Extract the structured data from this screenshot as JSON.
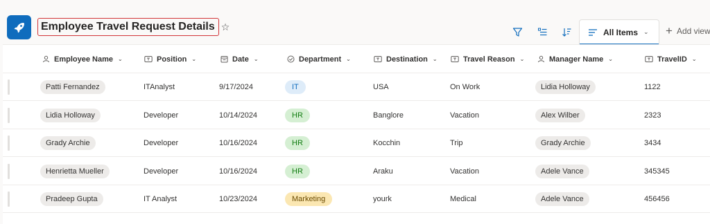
{
  "header": {
    "title": "Employee Travel Request Details",
    "star": "☆"
  },
  "toolbar": {
    "view_label": "All Items",
    "add_view_label": "Add view"
  },
  "columns": [
    {
      "label": "Employee Name",
      "icon": "person-icon"
    },
    {
      "label": "Position",
      "icon": "text-field-icon"
    },
    {
      "label": "Date",
      "icon": "calendar-icon"
    },
    {
      "label": "Department",
      "icon": "choice-icon"
    },
    {
      "label": "Destination",
      "icon": "text-field-icon"
    },
    {
      "label": "Travel Reason",
      "icon": "text-field-icon"
    },
    {
      "label": "Manager Name",
      "icon": "person-icon"
    },
    {
      "label": "TravelID",
      "icon": "text-field-icon"
    }
  ],
  "rows": [
    {
      "employee": "Patti Fernandez",
      "position": "ITAnalyst",
      "date": "9/17/2024",
      "department": "IT",
      "destination": "USA",
      "reason": "On Work",
      "manager": "Lidia Holloway",
      "travel_id": "1122"
    },
    {
      "employee": "Lidia Holloway",
      "position": "Developer",
      "date": "10/14/2024",
      "department": "HR",
      "destination": "Banglore",
      "reason": "Vacation",
      "manager": "Alex Wilber",
      "travel_id": "2323"
    },
    {
      "employee": "Grady Archie",
      "position": "Developer",
      "date": "10/16/2024",
      "department": "HR",
      "destination": "Kocchin",
      "reason": "Trip",
      "manager": "Grady Archie",
      "travel_id": "3434"
    },
    {
      "employee": "Henrietta Mueller",
      "position": "Developer",
      "date": "10/16/2024",
      "department": "HR",
      "destination": "Araku",
      "reason": "Vacation",
      "manager": "Adele Vance",
      "travel_id": "345345"
    },
    {
      "employee": "Pradeep Gupta",
      "position": "IT Analyst",
      "date": "10/23/2024",
      "department": "Marketing",
      "destination": "yourk",
      "reason": "Medical",
      "manager": "Adele Vance",
      "travel_id": "456456"
    }
  ],
  "department_colors": {
    "IT": {
      "bg": "#deecf9",
      "fg": "#0f6cbd"
    },
    "HR": {
      "bg": "#d5efd3",
      "fg": "#107c10"
    },
    "Marketing": {
      "bg": "#fbe7b2",
      "fg": "#6b4b00"
    }
  },
  "colors": {
    "accent": "#0f6cbd",
    "title_highlight_border": "#d13438"
  }
}
